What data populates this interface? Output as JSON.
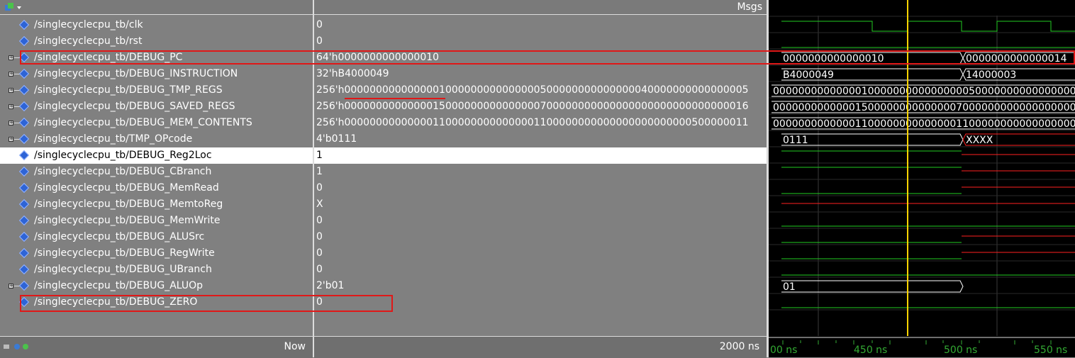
{
  "header": {
    "msgs_label": "Msgs"
  },
  "signals": [
    {
      "name": "/singlecyclecpu_tb/clk",
      "value": "0",
      "expandable": false
    },
    {
      "name": "/singlecyclecpu_tb/rst",
      "value": "0",
      "expandable": false
    },
    {
      "name": "/singlecyclecpu_tb/DEBUG_PC",
      "value": "64'h0000000000000010",
      "expandable": true
    },
    {
      "name": "/singlecyclecpu_tb/DEBUG_INSTRUCTION",
      "value": "32'hB4000049",
      "expandable": true
    },
    {
      "name": "/singlecyclecpu_tb/DEBUG_TMP_REGS",
      "value": "256'h0000000000000001000000000000000500000000000000040000000000000005",
      "expandable": true
    },
    {
      "name": "/singlecyclecpu_tb/DEBUG_SAVED_REGS",
      "value": "256'h0000000000000015000000000000000700000000000000000000000000000016",
      "expandable": true
    },
    {
      "name": "/singlecyclecpu_tb/DEBUG_MEM_CONTENTS",
      "value": "256'h0000000000000011000000000000001100000000000000000000000500000011",
      "expandable": true
    },
    {
      "name": "/singlecyclecpu_tb/TMP_OPcode",
      "value": "4'b0111",
      "expandable": true
    },
    {
      "name": "/singlecyclecpu_tb/DEBUG_Reg2Loc",
      "value": "1",
      "expandable": false,
      "selected": true
    },
    {
      "name": "/singlecyclecpu_tb/DEBUG_CBranch",
      "value": "1",
      "expandable": false
    },
    {
      "name": "/singlecyclecpu_tb/DEBUG_MemRead",
      "value": "0",
      "expandable": false
    },
    {
      "name": "/singlecyclecpu_tb/DEBUG_MemtoReg",
      "value": "X",
      "expandable": false
    },
    {
      "name": "/singlecyclecpu_tb/DEBUG_MemWrite",
      "value": "0",
      "expandable": false
    },
    {
      "name": "/singlecyclecpu_tb/DEBUG_ALUSrc",
      "value": "0",
      "expandable": false
    },
    {
      "name": "/singlecyclecpu_tb/DEBUG_RegWrite",
      "value": "0",
      "expandable": false
    },
    {
      "name": "/singlecyclecpu_tb/DEBUG_UBranch",
      "value": "0",
      "expandable": false
    },
    {
      "name": "/singlecyclecpu_tb/DEBUG_ALUOp",
      "value": "2'b01",
      "expandable": true
    },
    {
      "name": "/singlecyclecpu_tb/DEBUG_ZERO",
      "value": "0",
      "expandable": false
    }
  ],
  "wave_bus_labels": {
    "pc_a": "0000000000000010",
    "pc_b": "0000000000000014",
    "instr_a": "B4000049",
    "instr_b": "14000003",
    "tmp_regs": "0000000000000010000000000000000500000000000000000",
    "saved_regs": "0000000000000150000000000000070000000000000000000",
    "mem_contents": "0000000000000110000000000000011000000000000000000",
    "opcode_a": "0111",
    "opcode_b": "XXXX",
    "aluop_a": "01"
  },
  "footer": {
    "now_label": "Now",
    "now_value": "2000 ns",
    "ticks": [
      "00 ns",
      "450 ns",
      "500 ns",
      "550 ns"
    ]
  },
  "colors": {
    "cursor": "#ffd400",
    "wave_green": "#22cc22",
    "wave_red": "#ff2020",
    "annotation": "#e01818"
  }
}
